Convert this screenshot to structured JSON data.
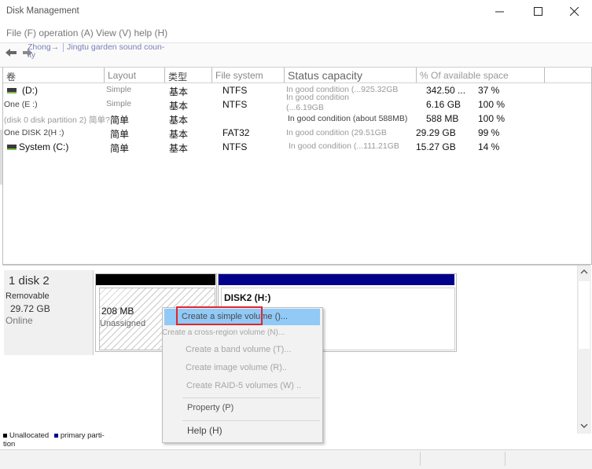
{
  "window": {
    "title": "Disk Management"
  },
  "menu": {
    "text": "File (F) operation (A) View (V) help (H)"
  },
  "toolbar": {
    "fragment1": "Zhong→",
    "fragment1b": "ity",
    "fragment2": "Jingtu garden sound coun-"
  },
  "columns": [
    "卷",
    "Layout",
    "类型",
    "File system",
    "Status capacity",
    "% Of available space"
  ],
  "volumes": [
    {
      "name": "(D:)",
      "layout": "Simple",
      "type": "基本",
      "fs": "NTFS",
      "status": "In good condition (...925.32GB",
      "capacity": "342.50 ...",
      "free": "37 %"
    },
    {
      "name": "One (E :)",
      "layout": "Simple",
      "type": "基本",
      "fs": "NTFS",
      "status": "In good condition",
      "status2": "(...6.19GB",
      "capacity": "6.16 GB",
      "free": "100 %"
    },
    {
      "name": "(disk 0 disk partition 2) 简单?",
      "layout": "简单",
      "type": "基本",
      "fs": "",
      "status": "In good condition (about 588MB)",
      "capacity": "588 MB",
      "free": "100 %"
    },
    {
      "name": "One DISK 2(H :)",
      "layout": "简单",
      "type": "基本",
      "fs": "FAT32",
      "status": "In good condition (29.51GB",
      "capacity": "29.29 GB",
      "free": "99 %"
    },
    {
      "name": "System (C:)",
      "layout": "简单",
      "type": "基本",
      "fs": "NTFS",
      "status": "In good condition (...111.21GB",
      "capacity": "15.27 GB",
      "free": "14 %"
    }
  ],
  "disk": {
    "title": "1 disk 2",
    "kind": "Removable",
    "size": "29.72 GB",
    "state": "Online",
    "part1_size": "208 MB",
    "part1_status": "Unassigned",
    "part2_label": "DISK2  (H:)"
  },
  "legend": {
    "unallocated": "Unallocated",
    "primary": "primary parti-",
    "primary_cont": "tion",
    "unallocated_color": "#000000",
    "primary_color": "#00008b"
  },
  "context_menu": {
    "items": [
      "Create a simple volume ()...",
      "Create a cross-region volume (N)...",
      "Create a band volume (T)...",
      "Create image volume (R)..",
      "Create RAID-5 volumes (W) ..",
      "Property (P)",
      "Help (H)"
    ]
  },
  "colors": {
    "highlight": "#91c9f7",
    "redbox": "#e0262d",
    "disk_bar": "#00008b"
  }
}
